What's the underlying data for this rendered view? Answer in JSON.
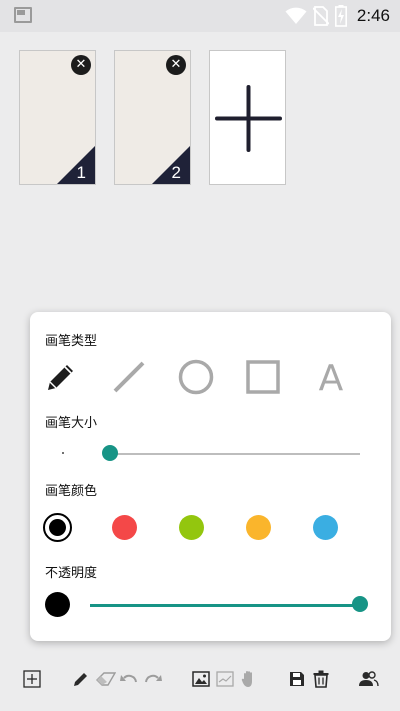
{
  "status_bar": {
    "time": "2:46",
    "icons": [
      "screen-icon",
      "wifi-icon",
      "no-sim-icon",
      "battery-charging-icon"
    ]
  },
  "pages": [
    {
      "number": "1",
      "close_icon": "close-icon"
    },
    {
      "number": "2",
      "close_icon": "close-icon"
    }
  ],
  "add_page_icon": "plus-icon",
  "brush_panel": {
    "type_label": "画笔类型",
    "types": [
      "pencil-icon",
      "line-icon",
      "circle-icon",
      "rectangle-icon",
      "text-icon"
    ],
    "selected_type": "pencil-icon",
    "text_tool_glyph": "A",
    "size_label": "画笔大小",
    "size_value": 0.0,
    "color_label": "画笔颜色",
    "colors": [
      "#000000",
      "#f44848",
      "#93c60e",
      "#fab52c",
      "#3aaee2"
    ],
    "selected_color": "#000000",
    "opacity_label": "不透明度",
    "opacity_value": 1.0,
    "accent_color": "#179486"
  },
  "toolbar": {
    "icons": [
      "add-page-icon",
      "pencil-icon",
      "eraser-icon",
      "undo-icon",
      "redo-icon",
      "image-icon",
      "background-icon",
      "hand-icon",
      "save-icon",
      "delete-icon",
      "share-icon"
    ]
  }
}
